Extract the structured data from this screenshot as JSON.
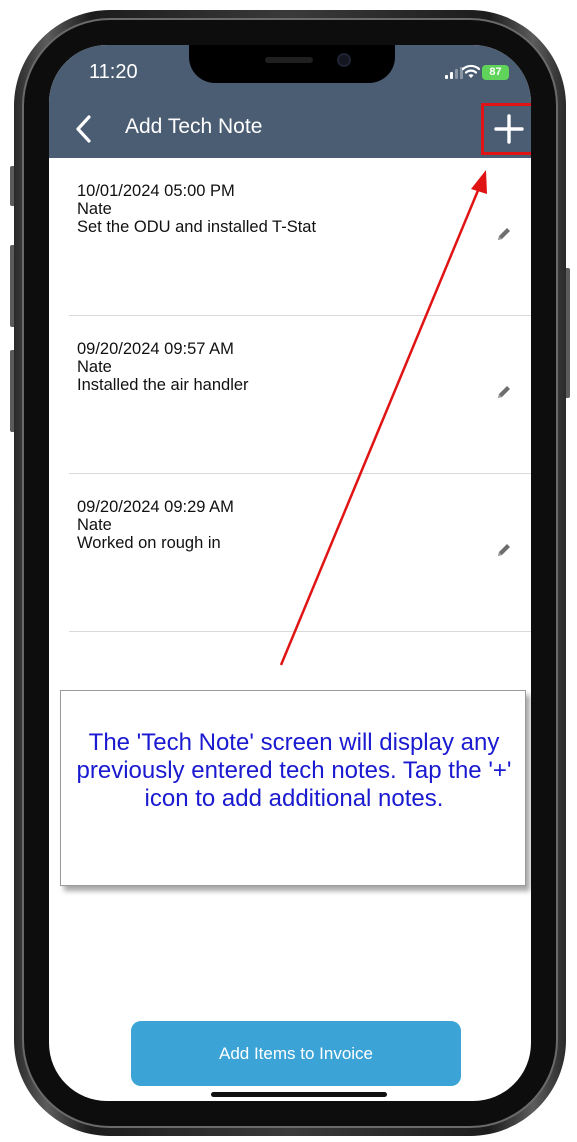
{
  "status_bar": {
    "time": "11:20",
    "battery": "87"
  },
  "header": {
    "title": "Add Tech Note",
    "back_icon": "chevron-left-icon",
    "add_icon": "plus-icon",
    "background_color": "#4b5d72",
    "highlight_color": "#e01414"
  },
  "notes": [
    {
      "datetime": "10/01/2024 05:00 PM",
      "tech": "Nate",
      "text": "Set the ODU and installed T-Stat",
      "edit_icon": "pencil-icon"
    },
    {
      "datetime": "09/20/2024 09:57 AM",
      "tech": "Nate",
      "text": "Installed the air handler",
      "edit_icon": "pencil-icon"
    },
    {
      "datetime": "09/20/2024 09:29 AM",
      "tech": "Nate",
      "text": "Worked on rough in",
      "edit_icon": "pencil-icon"
    }
  ],
  "callout": {
    "text": "The 'Tech Note' screen will display any previously entered tech notes. Tap the '+' icon to add additional notes.",
    "text_color": "#1a1ad0"
  },
  "footer": {
    "invoice_button_label": "Add Items to Invoice",
    "button_color": "#3ba3d6"
  }
}
